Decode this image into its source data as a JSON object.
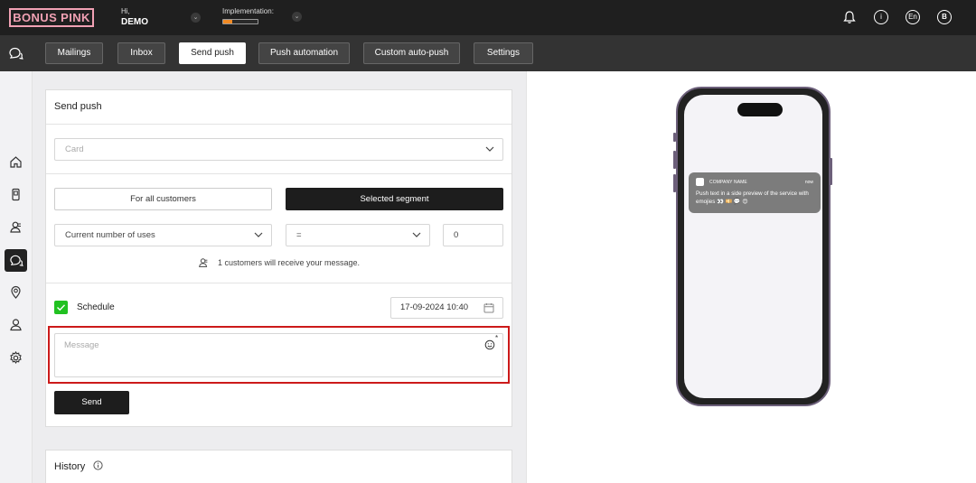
{
  "header": {
    "logo": "BONUS PINK",
    "greeting": "Hi,",
    "user": "DEMO",
    "implementation_label": "Implementation:",
    "implementation_progress": 0.25,
    "lang": "En",
    "avatar_initial": "B"
  },
  "nav": {
    "tabs": [
      {
        "label": "Mailings"
      },
      {
        "label": "Inbox"
      },
      {
        "label": "Send push"
      },
      {
        "label": "Push automation"
      },
      {
        "label": "Custom auto-push"
      },
      {
        "label": "Settings"
      }
    ],
    "active_tab": "Send push"
  },
  "sidebar": {
    "items": [
      "home-icon",
      "card-icon",
      "customers-icon",
      "chat-icon",
      "location-icon",
      "user-icon",
      "settings-icon"
    ],
    "active": "chat-icon"
  },
  "form": {
    "title": "Send push",
    "card_placeholder": "Card",
    "audience_all": "For all customers",
    "audience_segment": "Selected segment",
    "condition_field": "Current number of uses",
    "condition_operator": "=",
    "condition_value": "0",
    "recipients_text": "1 customers will receive your message.",
    "schedule_label": "Schedule",
    "schedule_checked": true,
    "schedule_date": "17-09-2024 10:40",
    "message_placeholder": "Message",
    "message_required_mark": "*",
    "send_label": "Send"
  },
  "history": {
    "title": "History"
  },
  "preview": {
    "app_name": "COMPANY NAME",
    "time": "now",
    "body": "Push text in a side preview of the service with emojies 👀 💴 💬 😍"
  },
  "colors": {
    "brand_pink": "#f1a1b4",
    "progress": "#f08a24",
    "checkbox": "#21c121",
    "highlight": "#cc1a1a"
  }
}
